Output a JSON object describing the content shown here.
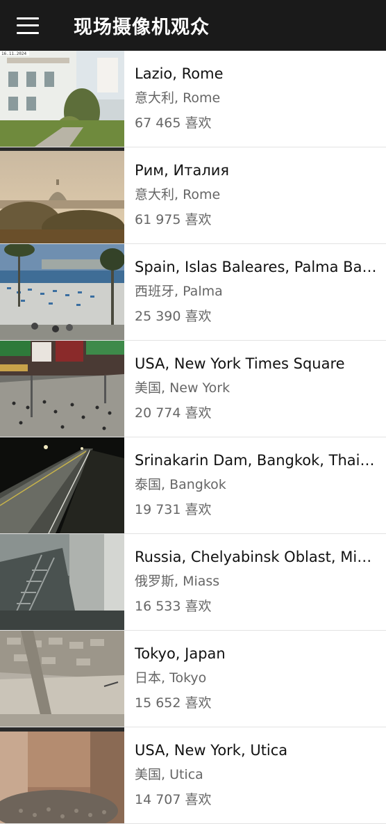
{
  "appbar": {
    "title": "现场摄像机观众",
    "menu_icon": "menu-icon"
  },
  "cameras": [
    {
      "title": "Lazio, Rome",
      "subtitle": "意大利, Rome",
      "likes": "67 465 喜欢",
      "overlay": "16.11.2024"
    },
    {
      "title": "Рим, Италия",
      "subtitle": "意大利, Rome",
      "likes": "61 975 喜欢",
      "overlay": ""
    },
    {
      "title": "Spain, Islas Baleares, Palma Ba…",
      "subtitle": "西班牙, Palma",
      "likes": "25 390 喜欢",
      "overlay": ""
    },
    {
      "title": "USA, New York Times Square",
      "subtitle": "美国, New York",
      "likes": "20 774 喜欢",
      "overlay": ""
    },
    {
      "title": "Srinakarin Dam, Bangkok, Thai…",
      "subtitle": "泰国, Bangkok",
      "likes": "19 731 喜欢",
      "overlay": ""
    },
    {
      "title": "Russia, Chelyabinsk Oblast, Mi…",
      "subtitle": "俄罗斯, Miass",
      "likes": "16 533 喜欢",
      "overlay": ""
    },
    {
      "title": "Tokyo, Japan",
      "subtitle": "日本, Tokyo",
      "likes": "15 652 喜欢",
      "overlay": ""
    },
    {
      "title": "USA, New York, Utica",
      "subtitle": "美国, Utica",
      "likes": "14 707 喜欢",
      "overlay": ""
    }
  ]
}
